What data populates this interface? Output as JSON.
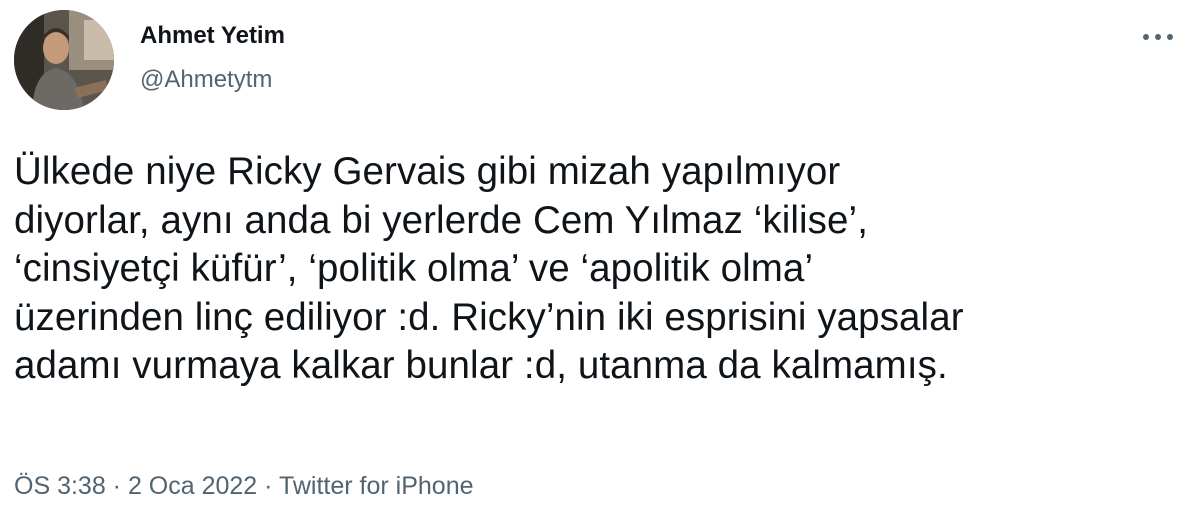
{
  "author": {
    "name": "Ahmet Yetim",
    "handle": "@Ahmetytm"
  },
  "tweet": {
    "text": "Ülkede niye Ricky Gervais gibi mizah yapılmıyor\ndiyorlar, aynı anda bi yerlerde Cem Yılmaz ‘kilise’,\n‘cinsiyetçi küfür’, ‘politik olma’ ve ‘apolitik olma’\nüzerinden linç ediliyor :d. Ricky’nin iki esprisini yapsalar\nadamı vurmaya kalkar bunlar :d, utanma da kalmamış."
  },
  "meta": {
    "time": "ÖS 3:38",
    "separator": " · ",
    "date": "2 Oca 2022",
    "source": "Twitter for iPhone"
  },
  "icons": {
    "more": "more-horizontal-icon"
  },
  "colors": {
    "text": "#0f1419",
    "secondary": "#536471",
    "background": "#ffffff"
  }
}
